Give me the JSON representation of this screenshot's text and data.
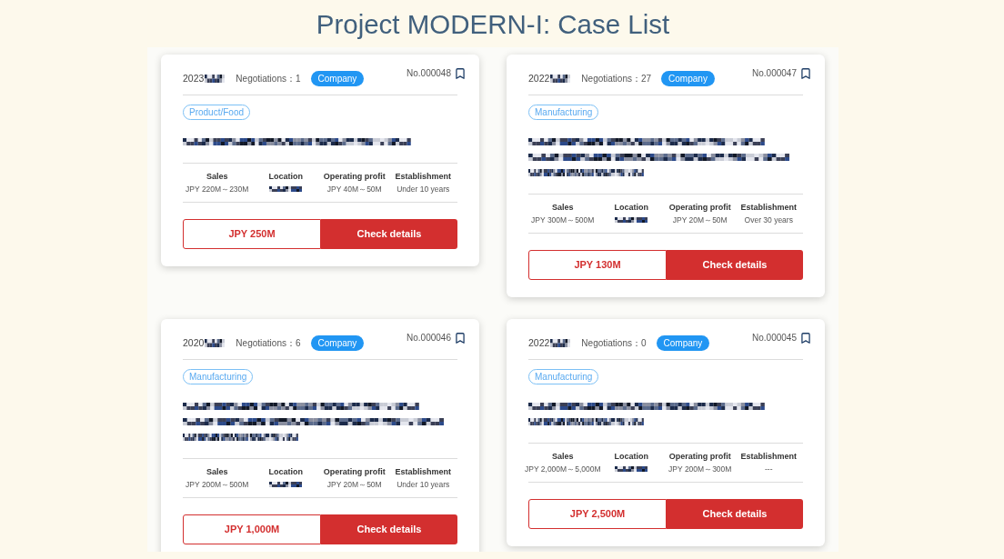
{
  "title": "Project MODERN-I: Case List",
  "cards": [
    {
      "date": "2023",
      "date_redacted": true,
      "negotiations": "Negotiations：1",
      "type": "Company",
      "number": "No.000048",
      "category": "Product/Food",
      "description": [
        {
          "kind": "redacted"
        }
      ],
      "stats": [
        {
          "label": "Sales",
          "kind": "text",
          "value": "JPY 220M～230M"
        },
        {
          "label": "Location",
          "kind": "redacted"
        },
        {
          "label": "Operating profit",
          "kind": "text",
          "value": "JPY 40M～50M"
        },
        {
          "label": "Establishment",
          "kind": "text",
          "value": "Under 10 years"
        }
      ],
      "price": "JPY 250M",
      "action": "Check details"
    },
    {
      "date": "2022",
      "date_redacted": true,
      "negotiations": "Negotiations：27",
      "type": "Company",
      "number": "No.000047",
      "category": "Manufacturing",
      "description": [
        {
          "kind": "redacted"
        },
        {
          "kind": "redacted"
        },
        {
          "kind": "redacted"
        }
      ],
      "stats": [
        {
          "label": "Sales",
          "kind": "text",
          "value": "JPY 300M～500M"
        },
        {
          "label": "Location",
          "kind": "redacted"
        },
        {
          "label": "Operating profit",
          "kind": "text",
          "value": "JPY 20M～50M"
        },
        {
          "label": "Establishment",
          "kind": "text",
          "value": "Over 30 years"
        }
      ],
      "price": "JPY 130M",
      "action": "Check details"
    },
    {
      "date": "2020",
      "date_redacted": true,
      "negotiations": "Negotiations：6",
      "type": "Company",
      "number": "No.000046",
      "category": "Manufacturing",
      "description": [
        {
          "kind": "redacted"
        },
        {
          "kind": "redacted"
        },
        {
          "kind": "redacted"
        }
      ],
      "stats": [
        {
          "label": "Sales",
          "kind": "text",
          "value": "JPY 200M～500M"
        },
        {
          "label": "Location",
          "kind": "redacted"
        },
        {
          "label": "Operating profit",
          "kind": "text",
          "value": "JPY 20M～50M"
        },
        {
          "label": "Establishment",
          "kind": "text",
          "value": "Under 10 years"
        }
      ],
      "price": "JPY 1,000M",
      "action": "Check details"
    },
    {
      "date": "2022",
      "date_redacted": true,
      "negotiations": "Negotiations：0",
      "type": "Company",
      "number": "No.000045",
      "category": "Manufacturing",
      "description": [
        {
          "kind": "redacted"
        },
        {
          "kind": "redacted"
        }
      ],
      "stats": [
        {
          "label": "Sales",
          "kind": "text",
          "value": "JPY 2,000M～5,000M"
        },
        {
          "label": "Location",
          "kind": "redacted"
        },
        {
          "label": "Operating profit",
          "kind": "text",
          "value": "JPY 200M～300M"
        },
        {
          "label": "Establishment",
          "kind": "text",
          "value": "---"
        }
      ],
      "price": "JPY 2,500M",
      "action": "Check details"
    }
  ]
}
